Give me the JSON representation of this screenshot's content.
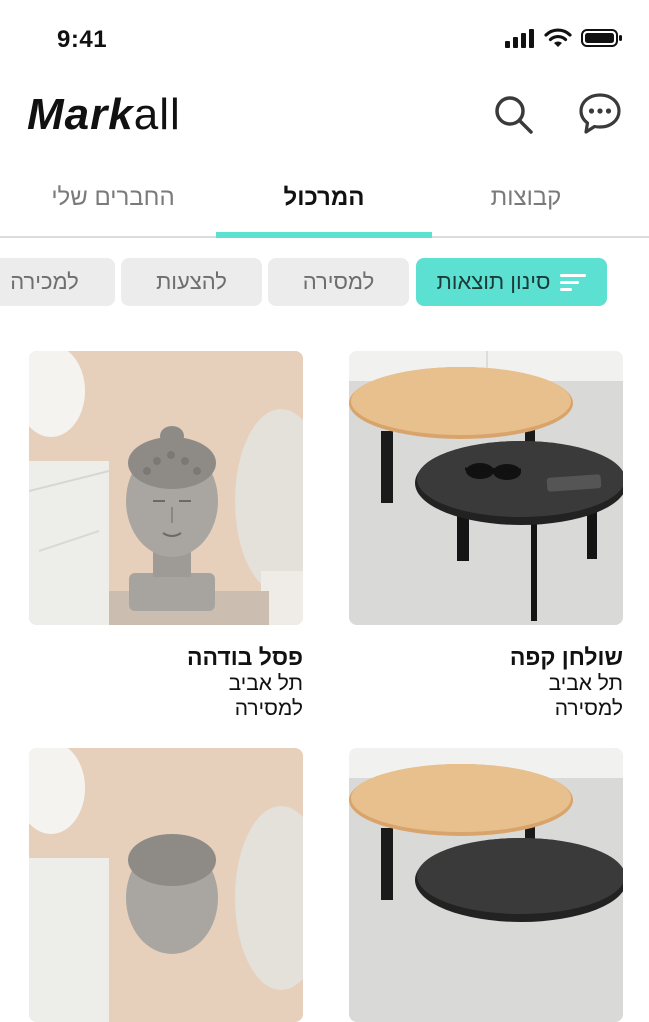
{
  "status_bar": {
    "time": "9:41"
  },
  "header": {
    "logo_prefix": "Mark",
    "logo_suffix": "all"
  },
  "tabs": [
    {
      "label": "קבוצות"
    },
    {
      "label": "המרכול"
    },
    {
      "label": "החברים שלי"
    }
  ],
  "active_tab": "המרכול",
  "filter_chips": [
    {
      "label": "סינון תוצאות",
      "icon": "filter-icon"
    },
    {
      "label": "למסירה"
    },
    {
      "label": "להצעות"
    },
    {
      "label": "למכירה"
    }
  ],
  "listings": [
    {
      "title": "שולחן קפה",
      "city": "תל אביב",
      "type": "למסירה",
      "image": "coffee-table"
    },
    {
      "title": "פסל בודהה",
      "city": "תל אביב",
      "type": "למסירה",
      "image": "buddha-statue"
    },
    {
      "title": "",
      "city": "",
      "type": "",
      "image": "coffee-table"
    },
    {
      "title": "",
      "city": "",
      "type": "",
      "image": "buddha-statue"
    }
  ],
  "colors": {
    "accent": "#5ce0d2",
    "chip_bg": "#ececec",
    "text": "#111111"
  }
}
